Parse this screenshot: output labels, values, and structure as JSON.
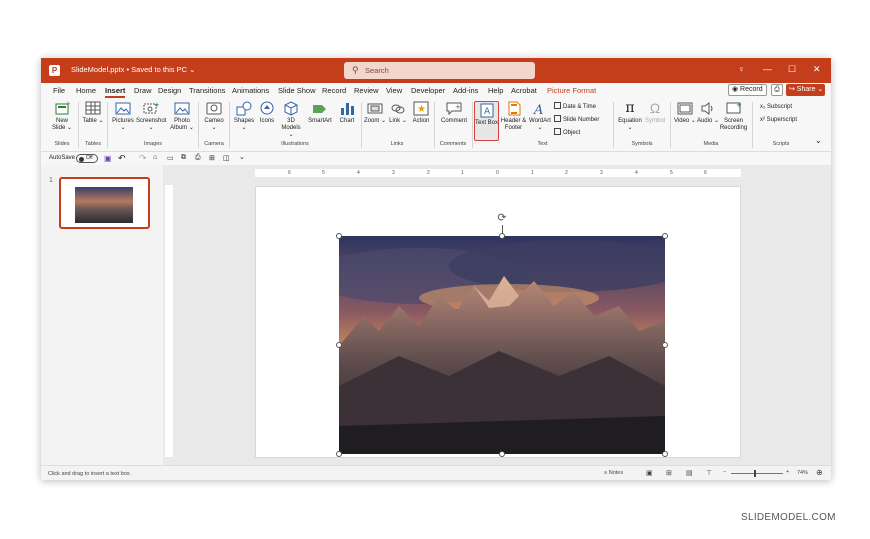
{
  "titlebar": {
    "file_name": "SlideModel.pptx • Saved to this PC ⌄",
    "search_placeholder": "Search",
    "icons": [
      "powerpoint-logo",
      "search-icon",
      "lightbulb-icon",
      "minimize-icon",
      "maximize-icon",
      "close-icon"
    ],
    "lightbulb": "♀",
    "minimize": "—",
    "maximize": "☐",
    "close": "✕",
    "logo": "P"
  },
  "menu": {
    "tabs": [
      "File",
      "Home",
      "Insert",
      "Draw",
      "Design",
      "Transitions",
      "Animations",
      "Slide Show",
      "Record",
      "Review",
      "View",
      "Developer",
      "Add-ins",
      "Help",
      "Acrobat",
      "Picture Format"
    ],
    "active_tab": "Insert",
    "record_label": "◉ Record",
    "comment_icon": "⎙",
    "share_label": "↪ Share ⌄"
  },
  "ribbon": {
    "groups": [
      "Slides",
      "Tables",
      "Images",
      "Camera",
      "Illustrations",
      "Links",
      "Comments",
      "Text",
      "Symbols",
      "Media",
      "Scripts"
    ],
    "buttons": {
      "new_slide": "New Slide ⌄",
      "table": "Table ⌄",
      "pictures": "Pictures ⌄",
      "screenshot": "Screenshot ⌄",
      "photo_album": "Photo Album ⌄",
      "cameo": "Cameo ⌄",
      "shapes": "Shapes ⌄",
      "icons": "Icons",
      "models_3d": "3D Models ⌄",
      "smartart": "SmartArt",
      "chart": "Chart",
      "zoom": "Zoom ⌄",
      "link": "Link ⌄",
      "action": "Action",
      "comment": "Comment",
      "text_box": "Text Box",
      "header_footer": "Header & Footer",
      "wordart": "WordArt ⌄",
      "date_time": "Date & Time",
      "slide_number": "Slide Number",
      "object": "Object",
      "equation": "Equation ⌄",
      "symbol": "Symbol",
      "video": "Video ⌄",
      "audio": "Audio ⌄",
      "screen_recording": "Screen Recording",
      "subscript": "Subscript",
      "superscript": "Superscript"
    },
    "subscript_glyph": "x₂",
    "superscript_glyph": "x²"
  },
  "qat": {
    "autosave_label": "AutoSave",
    "autosave_state": "Off",
    "icons": [
      "save-icon",
      "undo-icon",
      "redo-icon",
      "open-icon",
      "new-icon",
      "copy-icon",
      "print-icon",
      "present-icon",
      "shapes-icon",
      "more-icon"
    ]
  },
  "slides_panel": {
    "slide_number": "1"
  },
  "ruler": {
    "h_ticks": [
      "6",
      "5",
      "4",
      "3",
      "2",
      "1",
      "0",
      "1",
      "2",
      "3",
      "4",
      "5",
      "6"
    ]
  },
  "status": {
    "message": "Click and drag to insert a text box.",
    "notes_label": "≡ Notes",
    "zoom": "74%",
    "minus": "−",
    "plus": "+"
  },
  "watermark": "SLIDEMODEL.COM",
  "colors": {
    "accent": "#c43e1c",
    "selection": "#d9423c"
  }
}
